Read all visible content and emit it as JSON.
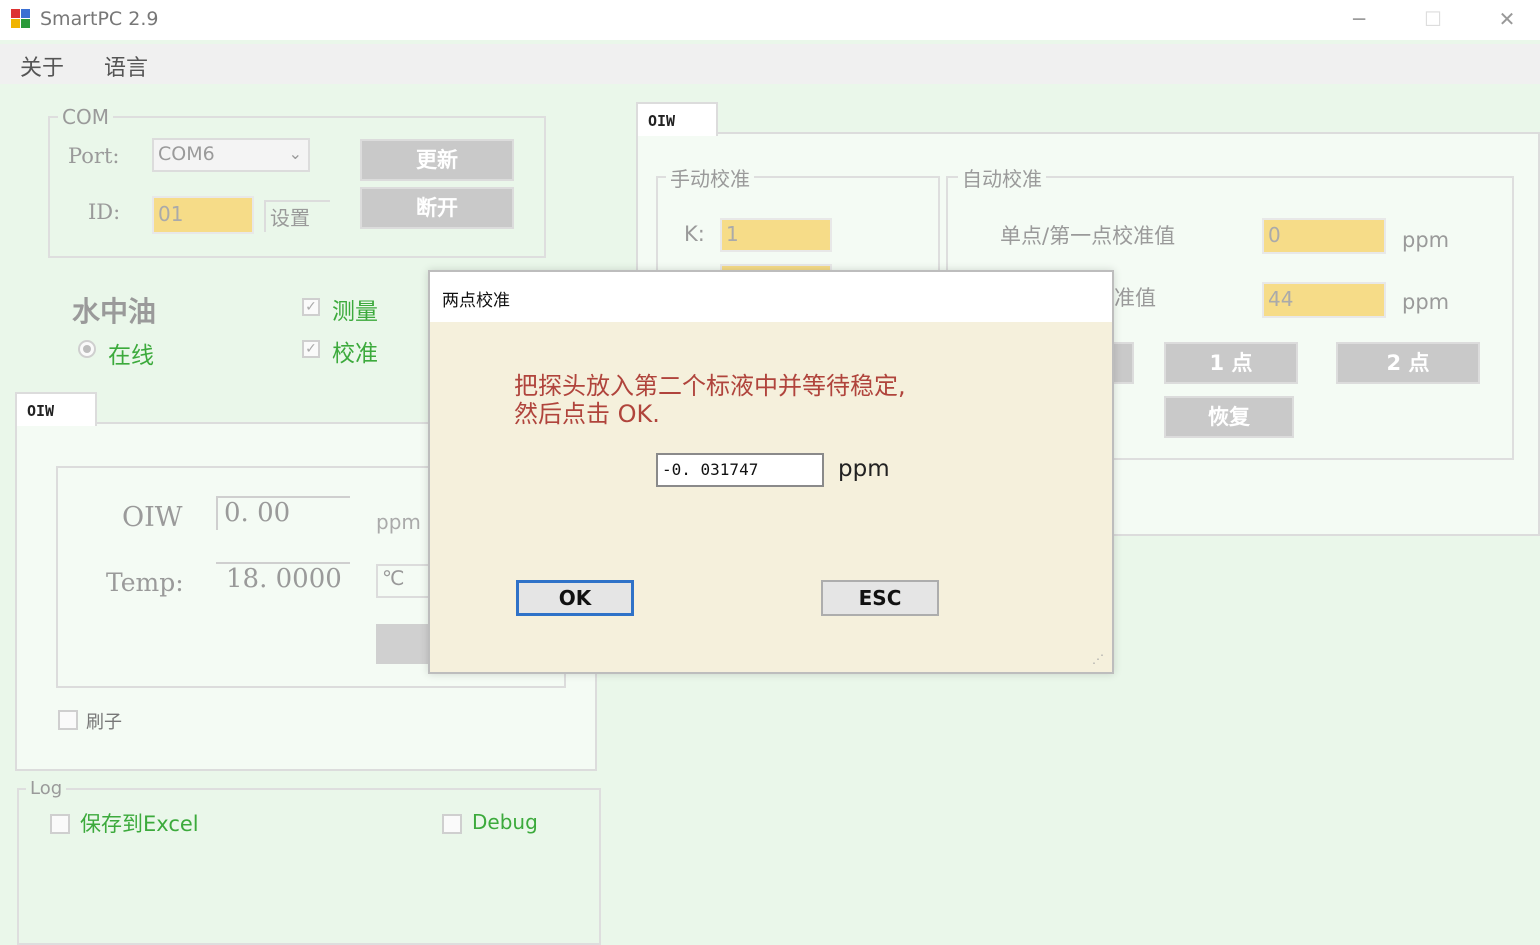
{
  "window": {
    "title": "SmartPC 2.9",
    "minimize": "─",
    "maximize": "☐",
    "close": "✕"
  },
  "menu": {
    "items": [
      "关于",
      "语言"
    ]
  },
  "com": {
    "legend": "COM",
    "port_label": "Port:",
    "port_value": "COM6",
    "id_label": "ID:",
    "id_value": "01",
    "set_label": "设置",
    "update_button": "更新",
    "disconnect_button": "断开"
  },
  "mode": {
    "title": "水中油",
    "online_label": "在线",
    "measure_label": "测量",
    "calibrate_label": "校准",
    "measure_checked": true,
    "calibrate_checked": true
  },
  "left_tab": {
    "tab_label": "OIW",
    "oiw_label": "OIW",
    "oiw_value": "0. 00",
    "oiw_unit": "ppm",
    "temp_label": "Temp:",
    "temp_value": "18. 0000",
    "temp_unit": "℃",
    "brush_label": "刷子"
  },
  "log": {
    "legend": "Log",
    "save_excel_label": "保存到Excel",
    "debug_label": "Debug"
  },
  "right_tab": {
    "tab_label": "OIW",
    "manual": {
      "legend": "手动校准",
      "k_label": "K:",
      "k_value": "1"
    },
    "auto": {
      "legend": "自动校准",
      "point1_label": "单点/第一点校准值",
      "point1_value": "0",
      "point1_unit": "ppm",
      "point2_label_partial": "准值",
      "point2_value": "44",
      "point2_unit": "ppm",
      "btn_1pt": "1 点",
      "btn_2pt": "2 点",
      "btn_restore": "恢复"
    }
  },
  "dialog": {
    "title": "两点校准",
    "message_line1": "把探头放入第二个标液中并等待稳定,",
    "message_line2": "然后点击 OK.",
    "value": "-0. 031747",
    "unit": "ppm",
    "ok_label": "OK",
    "esc_label": "ESC"
  }
}
